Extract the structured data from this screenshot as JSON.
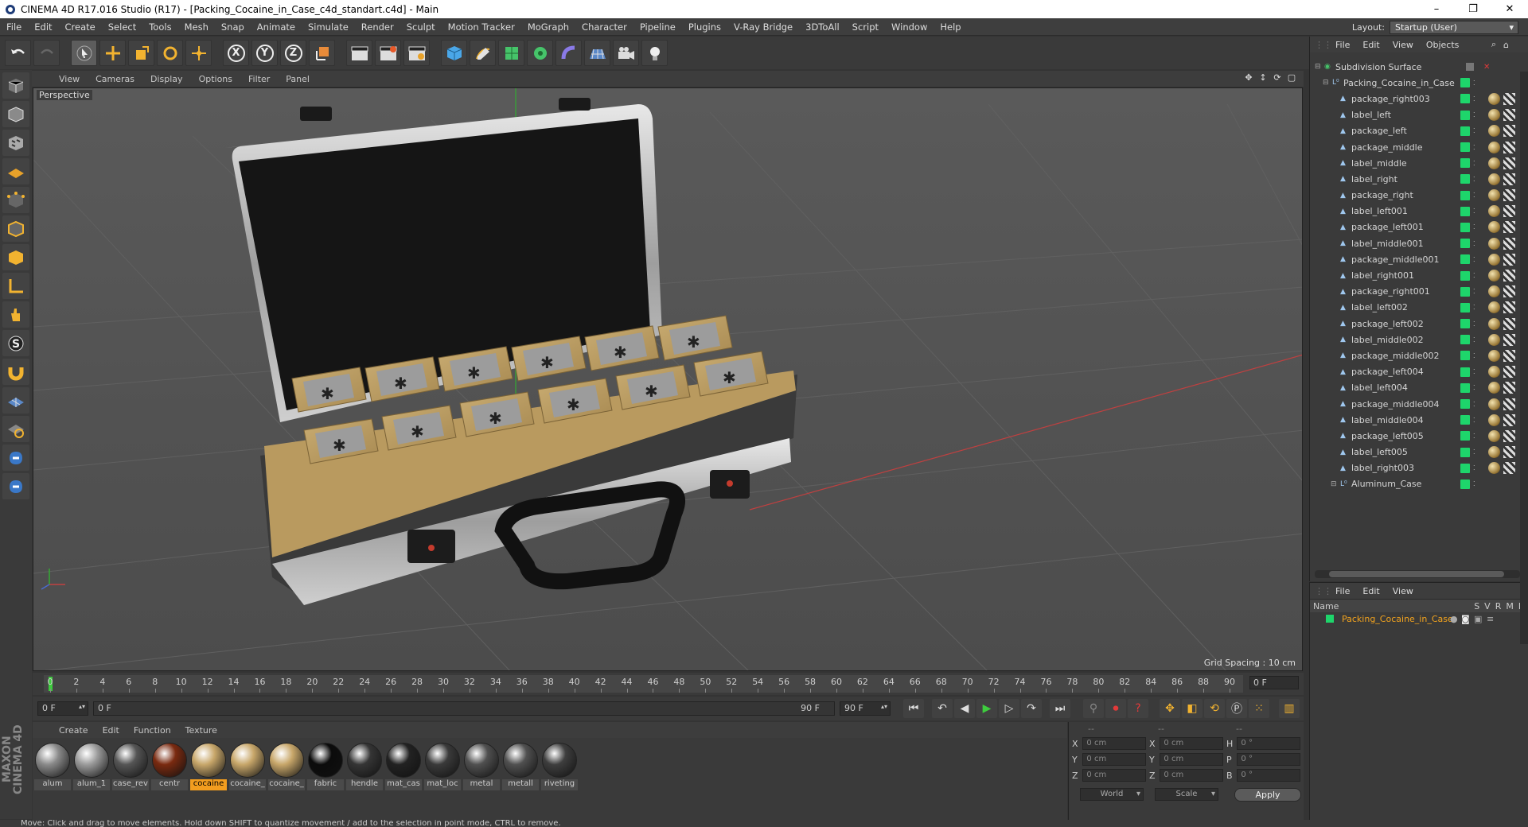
{
  "window": {
    "title": "CINEMA 4D R17.016 Studio (R17) - [Packing_Cocaine_in_Case_c4d_standart.c4d] - Main",
    "minimize": "–",
    "restore": "❐",
    "close": "✕"
  },
  "menu": [
    "File",
    "Edit",
    "Create",
    "Select",
    "Tools",
    "Mesh",
    "Snap",
    "Animate",
    "Simulate",
    "Render",
    "Sculpt",
    "Motion Tracker",
    "MoGraph",
    "Character",
    "Pipeline",
    "Plugins",
    "V-Ray Bridge",
    "3DToAll",
    "Script",
    "Window",
    "Help"
  ],
  "layout": {
    "label": "Layout:",
    "value": "Startup (User)"
  },
  "toolbar": {
    "x_label": "X",
    "y_label": "Y",
    "z_label": "Z"
  },
  "viewport": {
    "menu": [
      "View",
      "Cameras",
      "Display",
      "Options",
      "Filter",
      "Panel"
    ],
    "label": "Perspective",
    "grid_spacing": "Grid Spacing : 10 cm"
  },
  "timeline": {
    "ticks": [
      "0",
      "2",
      "4",
      "6",
      "8",
      "10",
      "12",
      "14",
      "16",
      "18",
      "20",
      "22",
      "24",
      "26",
      "28",
      "30",
      "32",
      "34",
      "36",
      "38",
      "40",
      "42",
      "44",
      "46",
      "48",
      "50",
      "52",
      "54",
      "56",
      "58",
      "60",
      "62",
      "64",
      "66",
      "68",
      "70",
      "72",
      "74",
      "76",
      "78",
      "80",
      "82",
      "84",
      "86",
      "88",
      "90"
    ],
    "end_field": "0 F",
    "current": 0,
    "max": 90
  },
  "transport": {
    "start": "0 F",
    "range_start": "0 F",
    "range_end": "90 F",
    "end": "90 F"
  },
  "materials": {
    "menu": [
      "Create",
      "Edit",
      "Function",
      "Texture"
    ],
    "items": [
      {
        "name": "alum",
        "color": "#8a8a8a",
        "selected": false
      },
      {
        "name": "alum_1",
        "color": "#9b9b9b",
        "selected": false
      },
      {
        "name": "case_rev",
        "color": "#555555",
        "selected": false
      },
      {
        "name": "centr",
        "color": "#7a2a10",
        "selected": false
      },
      {
        "name": "cocaine",
        "color": "#c8a76a",
        "selected": true
      },
      {
        "name": "cocaine_",
        "color": "#c8a76a",
        "selected": false
      },
      {
        "name": "cocaine_",
        "color": "#c8a76a",
        "selected": false
      },
      {
        "name": "fabric",
        "color": "#0b0b0b",
        "selected": false
      },
      {
        "name": "hendle",
        "color": "#353535",
        "selected": false
      },
      {
        "name": "mat_cas",
        "color": "#222222",
        "selected": false
      },
      {
        "name": "mat_loc",
        "color": "#3a3a3a",
        "selected": false
      },
      {
        "name": "metal",
        "color": "#505050",
        "selected": false
      },
      {
        "name": "metall",
        "color": "#505050",
        "selected": false
      },
      {
        "name": "riveting",
        "color": "#3e3e3e",
        "selected": false
      }
    ]
  },
  "coords": {
    "header": [
      "--",
      "--",
      "--"
    ],
    "rows": [
      {
        "a": "X",
        "av": "0 cm",
        "b": "X",
        "bv": "0 cm",
        "c": "H",
        "cv": "0 °"
      },
      {
        "a": "Y",
        "av": "0 cm",
        "b": "Y",
        "bv": "0 cm",
        "c": "P",
        "cv": "0 °"
      },
      {
        "a": "Z",
        "av": "0 cm",
        "b": "Z",
        "bv": "0 cm",
        "c": "B",
        "cv": "0 °"
      }
    ],
    "world": "World",
    "scale": "Scale",
    "apply": "Apply"
  },
  "objects": {
    "menu": [
      "File",
      "Edit",
      "View",
      "Objects"
    ],
    "tree": [
      {
        "name": "Subdivision Surface",
        "level": 0,
        "kind": "subdiv"
      },
      {
        "name": "Packing_Cocaine_in_Case",
        "level": 1,
        "kind": "null"
      },
      {
        "name": "package_right003",
        "level": 2,
        "kind": "obj"
      },
      {
        "name": "label_left",
        "level": 2,
        "kind": "obj"
      },
      {
        "name": "package_left",
        "level": 2,
        "kind": "obj"
      },
      {
        "name": "package_middle",
        "level": 2,
        "kind": "obj"
      },
      {
        "name": "label_middle",
        "level": 2,
        "kind": "obj"
      },
      {
        "name": "label_right",
        "level": 2,
        "kind": "obj"
      },
      {
        "name": "package_right",
        "level": 2,
        "kind": "obj"
      },
      {
        "name": "label_left001",
        "level": 2,
        "kind": "obj"
      },
      {
        "name": "package_left001",
        "level": 2,
        "kind": "obj"
      },
      {
        "name": "label_middle001",
        "level": 2,
        "kind": "obj"
      },
      {
        "name": "package_middle001",
        "level": 2,
        "kind": "obj"
      },
      {
        "name": "label_right001",
        "level": 2,
        "kind": "obj"
      },
      {
        "name": "package_right001",
        "level": 2,
        "kind": "obj"
      },
      {
        "name": "label_left002",
        "level": 2,
        "kind": "obj"
      },
      {
        "name": "package_left002",
        "level": 2,
        "kind": "obj"
      },
      {
        "name": "label_middle002",
        "level": 2,
        "kind": "obj"
      },
      {
        "name": "package_middle002",
        "level": 2,
        "kind": "obj"
      },
      {
        "name": "package_left004",
        "level": 2,
        "kind": "obj"
      },
      {
        "name": "label_left004",
        "level": 2,
        "kind": "obj"
      },
      {
        "name": "package_middle004",
        "level": 2,
        "kind": "obj"
      },
      {
        "name": "label_middle004",
        "level": 2,
        "kind": "obj"
      },
      {
        "name": "package_left005",
        "level": 2,
        "kind": "obj"
      },
      {
        "name": "label_left005",
        "level": 2,
        "kind": "obj"
      },
      {
        "name": "label_right003",
        "level": 2,
        "kind": "obj"
      },
      {
        "name": "Aluminum_Case",
        "level": 2,
        "kind": "null"
      }
    ]
  },
  "attributes": {
    "menu": [
      "File",
      "Edit",
      "View"
    ],
    "header": {
      "name": "Name",
      "cols": [
        "S",
        "V",
        "R",
        "M",
        "L"
      ]
    },
    "row": "Packing_Cocaine_in_Case"
  },
  "status": "Move: Click and drag to move elements. Hold down SHIFT to quantize movement / add to the selection in point mode, CTRL to remove."
}
